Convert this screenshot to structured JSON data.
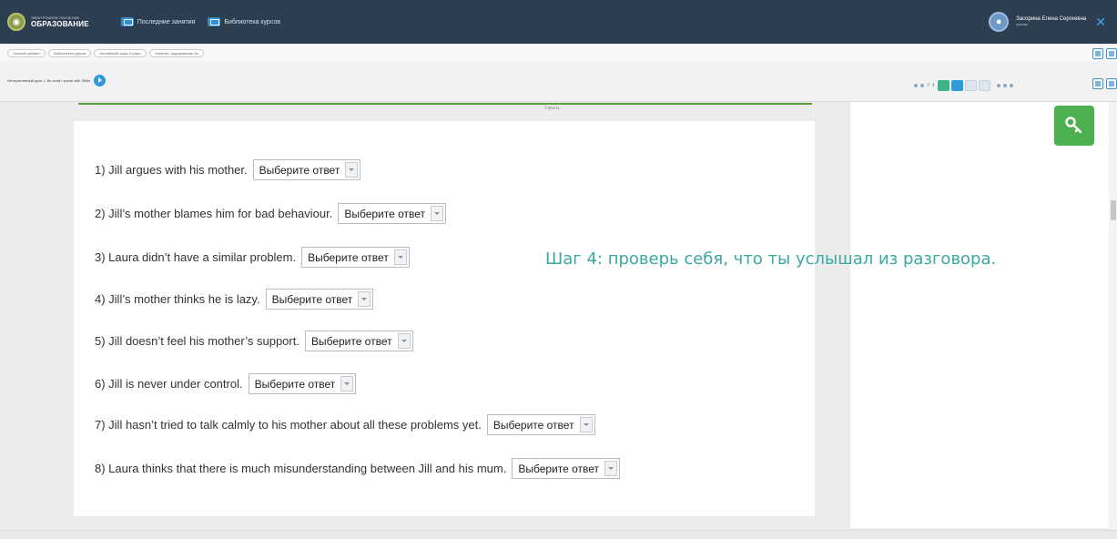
{
  "header": {
    "logo_small": "ЭЛЕКТРОННОЕ ОБУЧЕНИЕ",
    "logo_big": "ОБРАЗОВАНИЕ",
    "nav": [
      {
        "label": "Последние занятия"
      },
      {
        "label": "Библиотека курсов"
      }
    ],
    "user_name": "Засорина Елена Сергеевна",
    "user_role": "ученик"
  },
  "breadcrumbs": [
    "Личный кабинет",
    "Библиотека курсов",
    "Английский язык 9 класс",
    "Занятие: Аудирование 9а"
  ],
  "toolbar": {
    "lesson_label": "Интерактивный урок 1. Be what I speak with Stiller",
    "pager_nums": [
      "3",
      "4"
    ]
  },
  "section_label": "Скрыть",
  "questions": [
    {
      "text": "1) Jill argues with his mother.",
      "select": "Выберите ответ"
    },
    {
      "text": "2) Jill’s mother blames him for bad behaviour.",
      "select": "Выберите ответ"
    },
    {
      "text": "3) Laura didn’t have a similar problem.",
      "select": "Выберите ответ"
    },
    {
      "text": "4) Jill’s mother thinks he is lazy.",
      "select": "Выберите ответ"
    },
    {
      "text": "5) Jill doesn’t feel his mother’s support.",
      "select": "Выберите ответ"
    },
    {
      "text": "6) Jill is never under control.",
      "select": "Выберите ответ"
    },
    {
      "text": "7) Jill hasn’t tried to talk calmly to his mother about all these problems yet.",
      "select": "Выберите ответ"
    },
    {
      "text": "8) Laura thinks that there is much misunderstanding between Jill and his mum.",
      "select": "Выберите ответ"
    }
  ],
  "annotation": "Шаг 4: проверь себя, что ты услышал из разговора.",
  "colors": {
    "header_bg": "#2d3e50",
    "accent_green": "#4caf50",
    "annotation": "#3aa8a2",
    "accent_blue": "#2e9bd8"
  },
  "icons": {
    "key_button": "key-icon",
    "user": "user-icon",
    "close": "close-icon"
  }
}
